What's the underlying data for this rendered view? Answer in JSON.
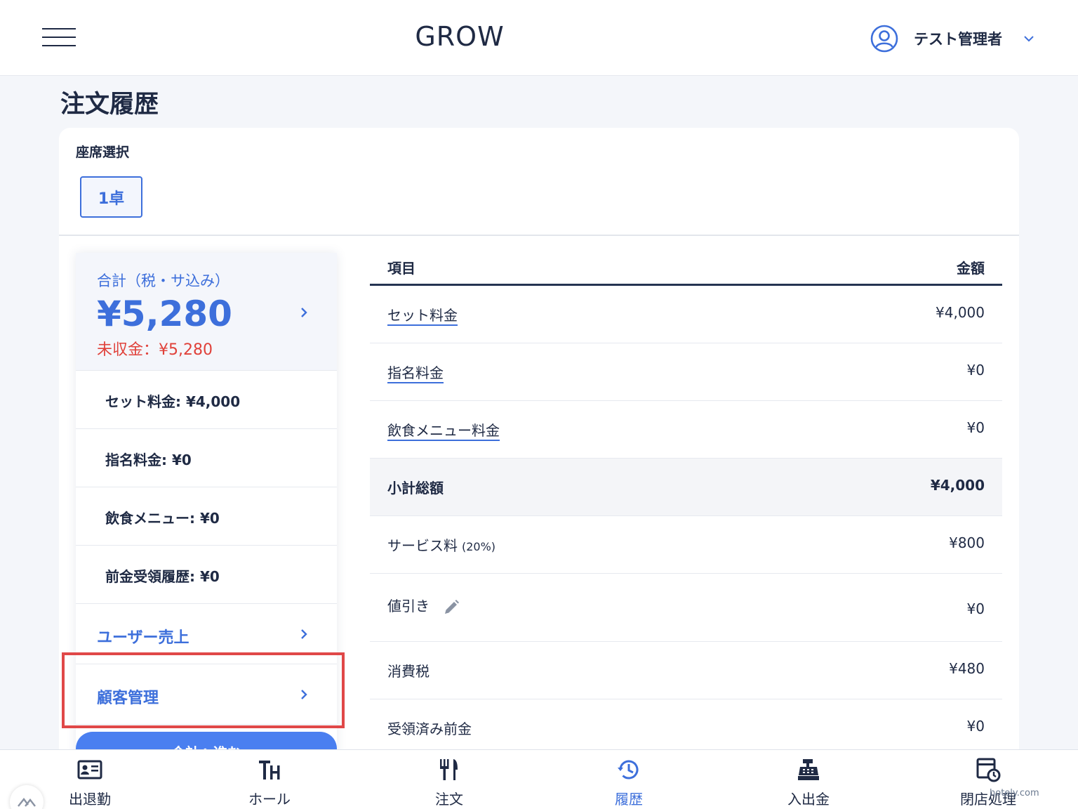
{
  "header": {
    "app_title": "GROW",
    "user_name": "テスト管理者"
  },
  "page": {
    "title": "注文履歴"
  },
  "seat": {
    "label": "座席選択",
    "selected": "1卓"
  },
  "summary": {
    "total_label": "合計（税・サ込み）",
    "total_amount": "¥5,280",
    "unpaid": "未収金：¥5,280",
    "rows": [
      "セット料金: ¥4,000",
      "指名料金: ¥0",
      "飲食メニュー: ¥0",
      "前金受領履歴: ¥0"
    ],
    "links": {
      "user_sales": "ユーザー売上",
      "customer_management": "顧客管理"
    },
    "checkout_button": "会計へ進む"
  },
  "table": {
    "headers": {
      "item": "項目",
      "amount": "金額"
    },
    "rows": [
      {
        "item": "セット料金",
        "amount": "¥4,000"
      },
      {
        "item": "指名料金",
        "amount": "¥0"
      },
      {
        "item": "飲食メニュー料金",
        "amount": "¥0"
      },
      {
        "item": "小計総額",
        "amount": "¥4,000"
      },
      {
        "item": "サービス料",
        "note": "(20%)",
        "amount": "¥800"
      },
      {
        "item": "値引き",
        "amount": "¥0"
      },
      {
        "item": "消費税",
        "amount": "¥480"
      },
      {
        "item": "受領済み前金",
        "amount": "¥0"
      }
    ]
  },
  "nav": {
    "items": [
      {
        "label": "出退勤",
        "icon": "id-card-icon"
      },
      {
        "label": "ホール",
        "icon": "table-hall-icon"
      },
      {
        "label": "注文",
        "icon": "fork-knife-icon"
      },
      {
        "label": "履歴",
        "icon": "history-icon"
      },
      {
        "label": "入出金",
        "icon": "cash-register-icon"
      },
      {
        "label": "閉店処理",
        "icon": "close-store-icon"
      }
    ],
    "active": "履歴"
  },
  "watermark": "hotely.com",
  "colors": {
    "accent": "#3d6fdb",
    "danger": "#e0413a",
    "highlight": "#e04848",
    "text": "#1f2a44"
  }
}
